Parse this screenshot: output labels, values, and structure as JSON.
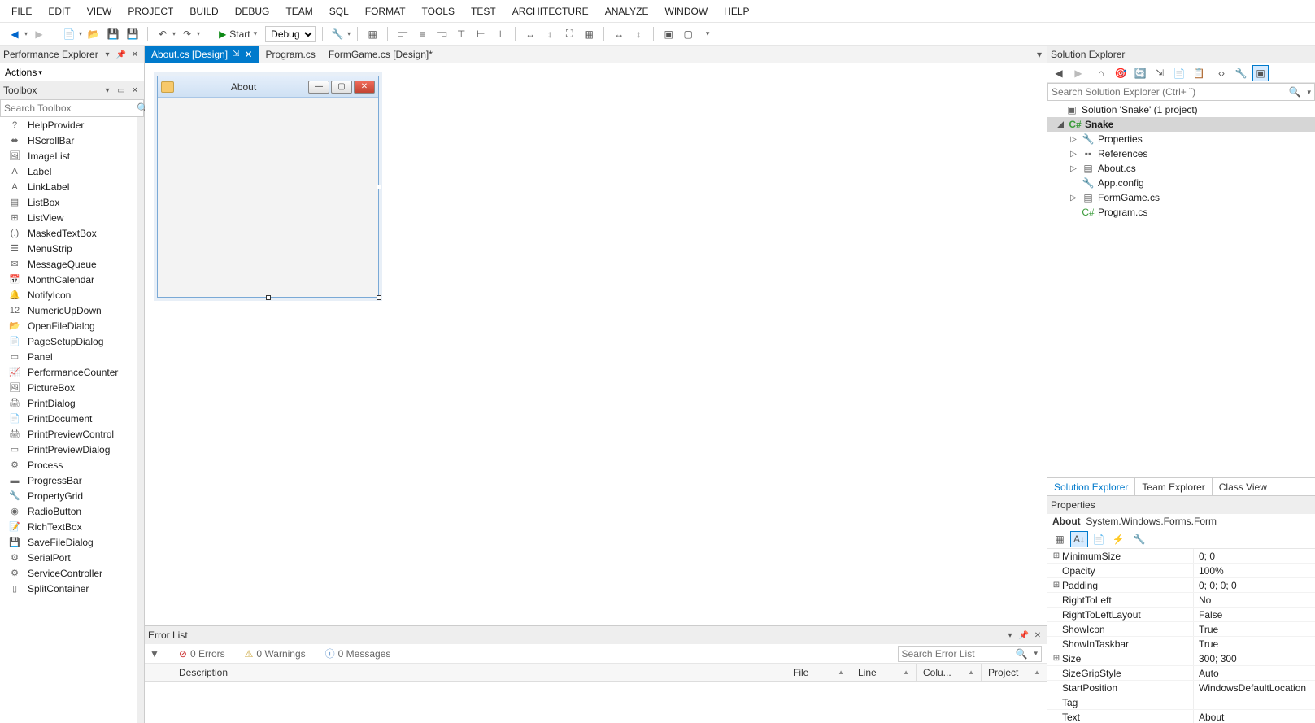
{
  "menu": [
    "FILE",
    "EDIT",
    "VIEW",
    "PROJECT",
    "BUILD",
    "DEBUG",
    "TEAM",
    "SQL",
    "FORMAT",
    "TOOLS",
    "TEST",
    "ARCHITECTURE",
    "ANALYZE",
    "WINDOW",
    "HELP"
  ],
  "toolbar": {
    "start_label": "Start",
    "config_value": "Debug"
  },
  "perf_explorer": {
    "title": "Performance Explorer",
    "actions_label": "Actions"
  },
  "toolbox": {
    "title": "Toolbox",
    "search_placeholder": "Search Toolbox",
    "items": [
      "HelpProvider",
      "HScrollBar",
      "ImageList",
      "Label",
      "LinkLabel",
      "ListBox",
      "ListView",
      "MaskedTextBox",
      "MenuStrip",
      "MessageQueue",
      "MonthCalendar",
      "NotifyIcon",
      "NumericUpDown",
      "OpenFileDialog",
      "PageSetupDialog",
      "Panel",
      "PerformanceCounter",
      "PictureBox",
      "PrintDialog",
      "PrintDocument",
      "PrintPreviewControl",
      "PrintPreviewDialog",
      "Process",
      "ProgressBar",
      "PropertyGrid",
      "RadioButton",
      "RichTextBox",
      "SaveFileDialog",
      "SerialPort",
      "ServiceController",
      "SplitContainer"
    ]
  },
  "tabs": [
    {
      "label": "About.cs [Design]",
      "active": true,
      "pinned": true
    },
    {
      "label": "Program.cs",
      "active": false
    },
    {
      "label": "FormGame.cs [Design]*",
      "active": false
    }
  ],
  "designer_form": {
    "title": "About"
  },
  "error_list": {
    "title": "Error List",
    "errors_label": "0 Errors",
    "warnings_label": "0 Warnings",
    "messages_label": "0 Messages",
    "search_placeholder": "Search Error List",
    "columns": [
      "",
      "Description",
      "File",
      "Line",
      "Colu...",
      "Project"
    ]
  },
  "solution_explorer": {
    "title": "Solution Explorer",
    "search_placeholder": "Search Solution Explorer (Ctrl+ ˇ)",
    "root": "Solution 'Snake' (1 project)",
    "project": "Snake",
    "children": [
      "Properties",
      "References",
      "About.cs",
      "App.config",
      "FormGame.cs",
      "Program.cs"
    ],
    "bottom_tabs": [
      "Solution Explorer",
      "Team Explorer",
      "Class View"
    ]
  },
  "properties": {
    "title": "Properties",
    "object_name": "About",
    "object_type": "System.Windows.Forms.Form",
    "rows": [
      {
        "exp": "+",
        "name": "MinimumSize",
        "val": "0; 0"
      },
      {
        "exp": "",
        "name": "Opacity",
        "val": "100%"
      },
      {
        "exp": "+",
        "name": "Padding",
        "val": "0; 0; 0; 0"
      },
      {
        "exp": "",
        "name": "RightToLeft",
        "val": "No"
      },
      {
        "exp": "",
        "name": "RightToLeftLayout",
        "val": "False"
      },
      {
        "exp": "",
        "name": "ShowIcon",
        "val": "True"
      },
      {
        "exp": "",
        "name": "ShowInTaskbar",
        "val": "True"
      },
      {
        "exp": "+",
        "name": "Size",
        "val": "300; 300"
      },
      {
        "exp": "",
        "name": "SizeGripStyle",
        "val": "Auto"
      },
      {
        "exp": "",
        "name": "StartPosition",
        "val": "WindowsDefaultLocation"
      },
      {
        "exp": "",
        "name": "Tag",
        "val": ""
      },
      {
        "exp": "",
        "name": "Text",
        "val": "About"
      }
    ]
  }
}
